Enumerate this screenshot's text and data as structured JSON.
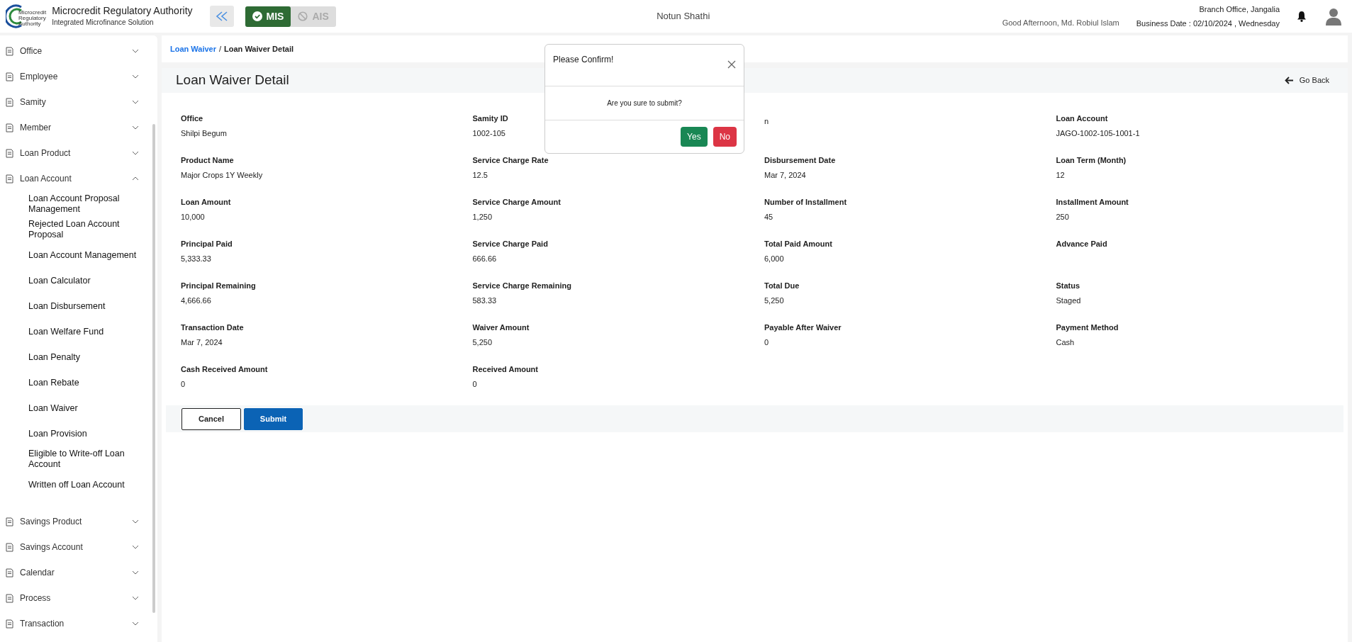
{
  "header": {
    "logo_text": [
      "Microcredit",
      "Regulatory",
      "Authority"
    ],
    "title": "Microcredit Regulatory Authority",
    "subtitle": "Integrated Microfinance Solution",
    "modules": [
      {
        "label": "MIS",
        "selected": true
      },
      {
        "label": "AIS",
        "selected": false
      }
    ],
    "app_name": "Notun Shathi",
    "greeting": "Good Afternoon, Md. Robiul Islam",
    "branch": "Branch Office, Jangalia",
    "business_date": "Business Date : 02/10/2024 , Wednesday"
  },
  "sidebar": {
    "items": [
      {
        "label": "Office",
        "expanded": false
      },
      {
        "label": "Employee",
        "expanded": false
      },
      {
        "label": "Samity",
        "expanded": false
      },
      {
        "label": "Member",
        "expanded": false
      },
      {
        "label": "Loan Product",
        "expanded": false
      },
      {
        "label": "Loan Account",
        "expanded": true,
        "children": [
          {
            "label": "Loan Account Proposal Management"
          },
          {
            "label": "Rejected Loan Account Proposal"
          },
          {
            "label": "Loan Account Management"
          },
          {
            "label": "Loan Calculator"
          },
          {
            "label": "Loan Disbursement"
          },
          {
            "label": "Loan Welfare Fund"
          },
          {
            "label": "Loan Penalty"
          },
          {
            "label": "Loan Rebate"
          },
          {
            "label": "Loan Waiver"
          },
          {
            "label": "Loan Provision"
          },
          {
            "label": "Eligible to Write-off Loan Account"
          },
          {
            "label": "Written off Loan Account"
          }
        ]
      },
      {
        "label": "Savings Product",
        "expanded": false
      },
      {
        "label": "Savings Account",
        "expanded": false
      },
      {
        "label": "Calendar",
        "expanded": false
      },
      {
        "label": "Process",
        "expanded": false
      },
      {
        "label": "Transaction",
        "expanded": false
      }
    ]
  },
  "breadcrumb_separator": "/",
  "breadcrumb": [
    {
      "label": "Loan Waiver",
      "current": false
    },
    {
      "label": "Loan Waiver Detail",
      "current": true
    }
  ],
  "page_title": "Loan Waiver Detail",
  "go_back": "Go Back",
  "fields": [
    {
      "label": "Office",
      "value": "Shilpi Begum"
    },
    {
      "label": "Samity ID",
      "value": "1002-105"
    },
    {
      "value": "n"
    },
    {
      "label": "Loan Account",
      "value": "JAGO-1002-105-1001-1"
    },
    {
      "label": "Product Name",
      "value": "Major Crops 1Y Weekly"
    },
    {
      "label": "Service Charge Rate",
      "value": "12.5"
    },
    {
      "label": "Disbursement Date",
      "value": "Mar 7, 2024"
    },
    {
      "label": "Loan Term (Month)",
      "value": "12"
    },
    {
      "label": "Loan Amount",
      "value": "10,000"
    },
    {
      "label": "Service Charge Amount",
      "value": "1,250"
    },
    {
      "label": "Number of Installment",
      "value": "45"
    },
    {
      "label": "Installment Amount",
      "value": "250"
    },
    {
      "label": "Principal Paid",
      "value": "5,333.33"
    },
    {
      "label": "Service Charge Paid",
      "value": "666.66"
    },
    {
      "label": "Total Paid Amount",
      "value": "6,000"
    },
    {
      "label": "Advance Paid"
    },
    {
      "label": "Principal Remaining",
      "value": "4,666.66"
    },
    {
      "label": "Service Charge Remaining",
      "value": "583.33"
    },
    {
      "label": "Total Due",
      "value": "5,250"
    },
    {
      "label": "Status",
      "value": "Staged"
    },
    {
      "label": "Transaction Date",
      "value": "Mar 7, 2024"
    },
    {
      "label": "Waiver Amount",
      "value": "5,250"
    },
    {
      "label": "Payable After Waiver",
      "value": "0"
    },
    {
      "label": "Payment Method",
      "value": "Cash"
    },
    {
      "label": "Cash Received Amount",
      "value": "0"
    },
    {
      "label": "Received Amount",
      "value": "0"
    }
  ],
  "actions": [
    {
      "label": "Cancel",
      "kind": "outline"
    },
    {
      "label": "Submit",
      "kind": "primary"
    }
  ],
  "modal": {
    "title": "Please Confirm!",
    "message": "Are you sure to submit?",
    "buttons": [
      {
        "label": "Yes",
        "kind": "confirm"
      },
      {
        "label": "No",
        "kind": "deny"
      }
    ]
  }
}
